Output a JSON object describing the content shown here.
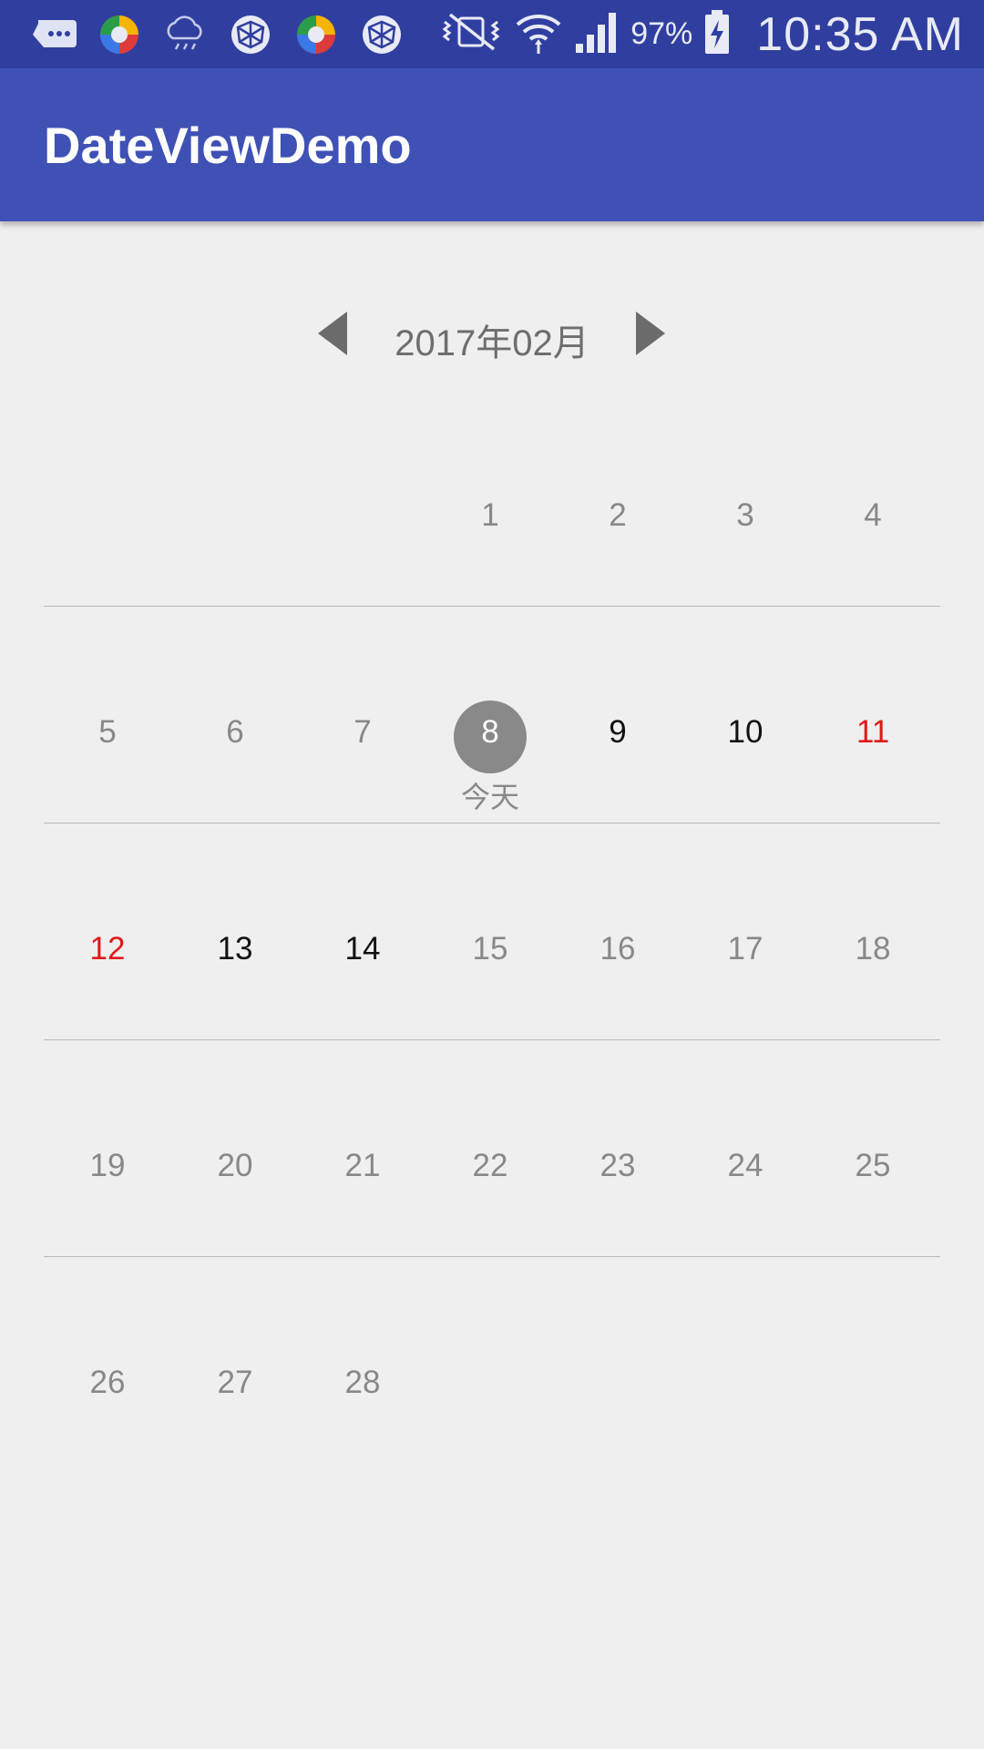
{
  "status_bar": {
    "left_icons": [
      "message-icon",
      "color-app-icon",
      "cloud-rain-icon",
      "globe-icon",
      "color-app-icon",
      "globe-icon"
    ],
    "right_icons": [
      "mute-vibrate-icon",
      "wifi-icon",
      "signal-icon"
    ],
    "battery_percent": "97%",
    "time": "10:35 AM"
  },
  "app_bar": {
    "title": "DateViewDemo"
  },
  "month_nav": {
    "label": "2017年02月",
    "prev_icon": "triangle-left-icon",
    "next_icon": "triangle-right-icon"
  },
  "calendar": {
    "colors": {
      "muted": "#888888",
      "active": "#111111",
      "holiday": "#e01919",
      "today_circle": "#898989"
    },
    "weeks": [
      [
        {
          "day": ""
        },
        {
          "day": ""
        },
        {
          "day": ""
        },
        {
          "day": "1",
          "state": "muted"
        },
        {
          "day": "2",
          "state": "muted"
        },
        {
          "day": "3",
          "state": "muted"
        },
        {
          "day": "4",
          "state": "muted"
        }
      ],
      [
        {
          "day": "5",
          "state": "muted"
        },
        {
          "day": "6",
          "state": "muted"
        },
        {
          "day": "7",
          "state": "muted"
        },
        {
          "day": "8",
          "state": "today",
          "sublabel": "今天"
        },
        {
          "day": "9",
          "state": "active"
        },
        {
          "day": "10",
          "state": "active"
        },
        {
          "day": "11",
          "state": "holiday"
        }
      ],
      [
        {
          "day": "12",
          "state": "holiday"
        },
        {
          "day": "13",
          "state": "active"
        },
        {
          "day": "14",
          "state": "active"
        },
        {
          "day": "15",
          "state": "muted"
        },
        {
          "day": "16",
          "state": "muted"
        },
        {
          "day": "17",
          "state": "muted"
        },
        {
          "day": "18",
          "state": "muted"
        }
      ],
      [
        {
          "day": "19",
          "state": "muted"
        },
        {
          "day": "20",
          "state": "muted"
        },
        {
          "day": "21",
          "state": "muted"
        },
        {
          "day": "22",
          "state": "muted"
        },
        {
          "day": "23",
          "state": "muted"
        },
        {
          "day": "24",
          "state": "muted"
        },
        {
          "day": "25",
          "state": "muted"
        }
      ],
      [
        {
          "day": "26",
          "state": "muted"
        },
        {
          "day": "27",
          "state": "muted"
        },
        {
          "day": "28",
          "state": "muted"
        },
        {
          "day": ""
        },
        {
          "day": ""
        },
        {
          "day": ""
        },
        {
          "day": ""
        }
      ]
    ]
  }
}
